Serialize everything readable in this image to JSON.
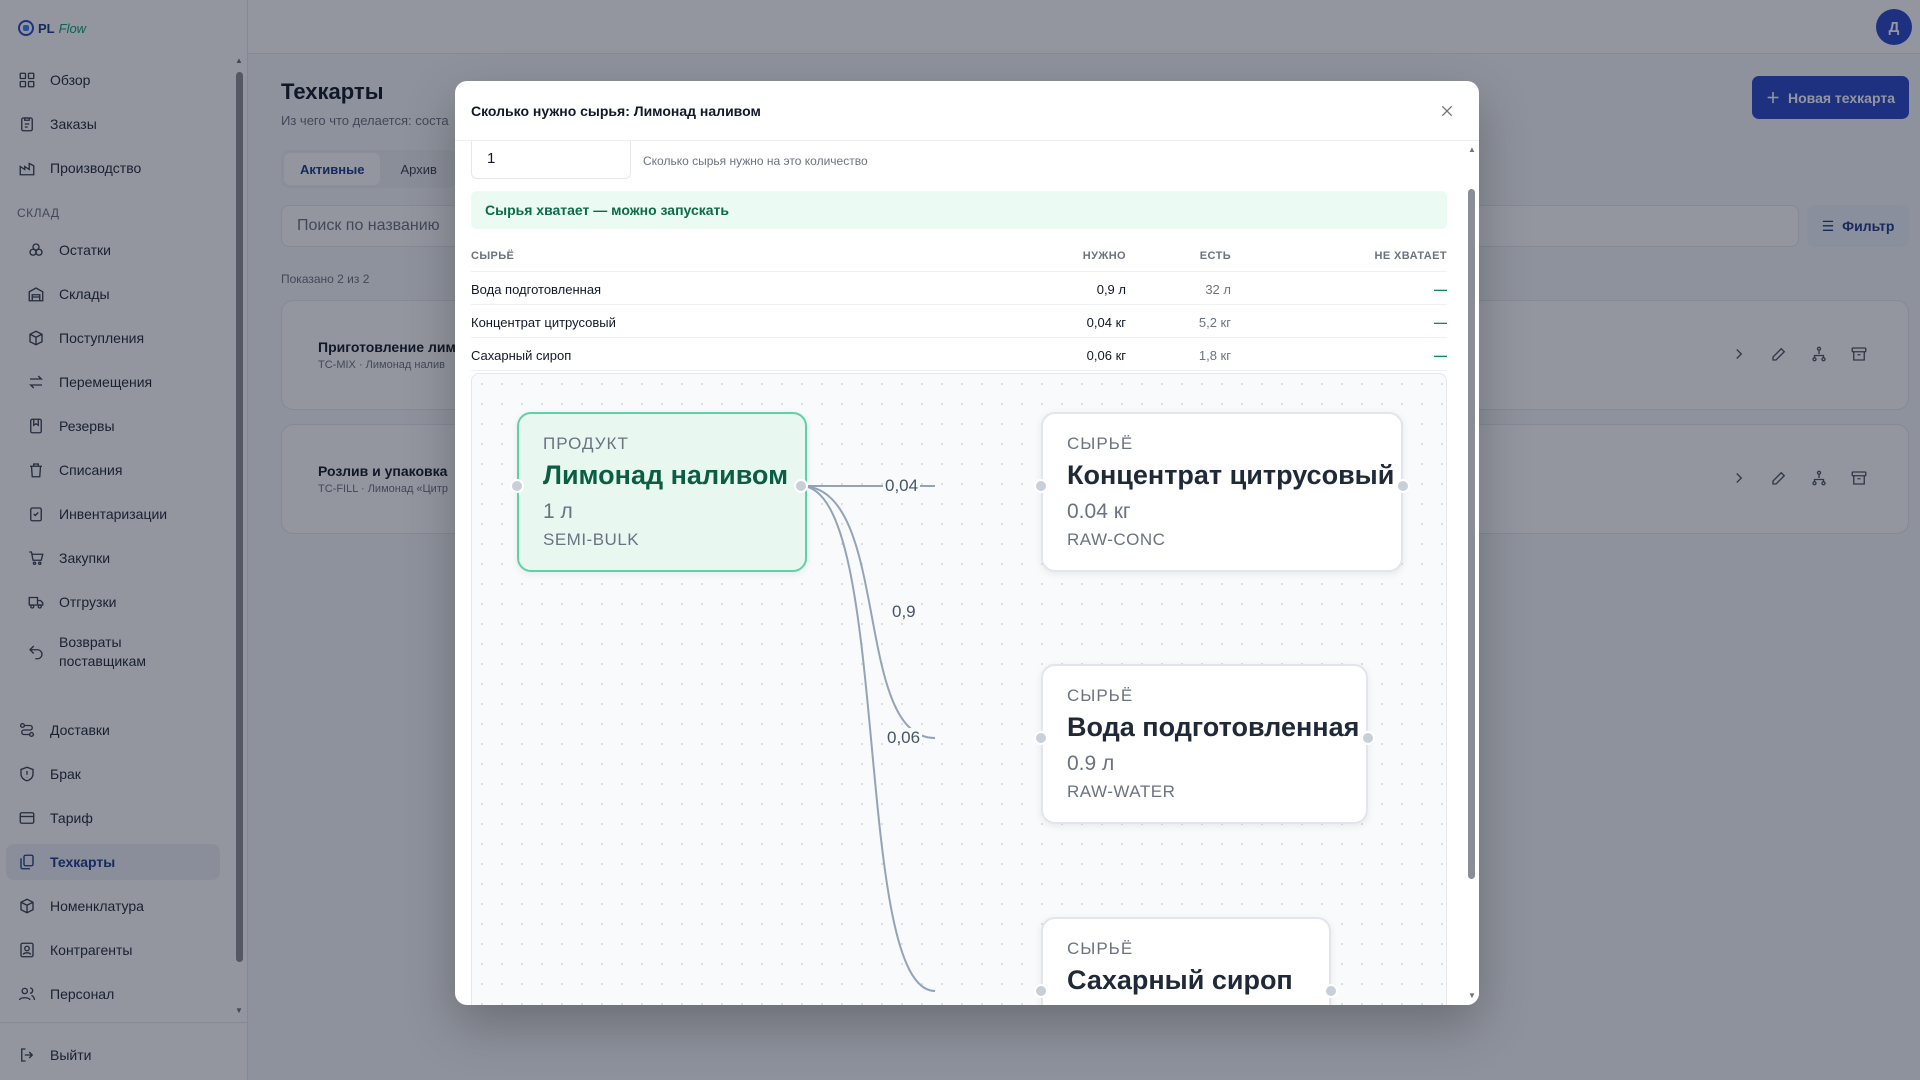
{
  "app": {
    "logo_prefix": "PL",
    "logo_suffix": "Flow",
    "user_initial": "Д"
  },
  "sidebar": {
    "items": [
      {
        "label": "Обзор",
        "icon": "grid-icon"
      },
      {
        "label": "Заказы",
        "icon": "clipboard-icon"
      },
      {
        "label": "Производство",
        "icon": "factory-icon"
      }
    ],
    "section_label": "СКЛАД",
    "warehouse_items": [
      {
        "label": "Остатки",
        "icon": "boxes-icon"
      },
      {
        "label": "Склады",
        "icon": "warehouse-icon"
      },
      {
        "label": "Поступления",
        "icon": "package-in-icon"
      },
      {
        "label": "Перемещения",
        "icon": "transfer-icon"
      },
      {
        "label": "Резервы",
        "icon": "bookmark-icon"
      },
      {
        "label": "Списания",
        "icon": "trash-icon"
      },
      {
        "label": "Инвентаризации",
        "icon": "checklist-icon"
      },
      {
        "label": "Закупки",
        "icon": "cart-icon"
      },
      {
        "label": "Отгрузки",
        "icon": "truck-icon"
      },
      {
        "label": "Возвраты поставщикам",
        "icon": "return-icon"
      }
    ],
    "bottom_items": [
      {
        "label": "Доставки",
        "icon": "route-icon"
      },
      {
        "label": "Брак",
        "icon": "shield-icon"
      },
      {
        "label": "Тариф",
        "icon": "card-icon"
      },
      {
        "label": "Техкарты",
        "icon": "layers-icon",
        "active": true
      },
      {
        "label": "Номенклатура",
        "icon": "box-icon"
      },
      {
        "label": "Контрагенты",
        "icon": "contacts-icon"
      },
      {
        "label": "Персонал",
        "icon": "users-icon"
      }
    ],
    "logout_label": "Выйти"
  },
  "page": {
    "title": "Техкарты",
    "subtitle": "Из чего что делается: соста",
    "new_button": "Новая техкарта",
    "tabs": [
      "Активные",
      "Архив"
    ],
    "search_placeholder": "Поиск по названию",
    "filter_label": "Фильтр",
    "shown_text": "Показано 2 из 2",
    "cards": [
      {
        "title": "Приготовление лимо",
        "subtitle": "TC-MIX · Лимонад налив"
      },
      {
        "title": "Розлив и упаковка",
        "subtitle": "TC-FILL · Лимонад «Цитр"
      }
    ]
  },
  "modal": {
    "title": "Сколько нужно сырья: Лимонад наливом",
    "quantity_value": "1",
    "quantity_hint": "Сколько сырья нужно на это количество",
    "status_banner": "Сырья хватает — можно запускать",
    "table": {
      "headers": [
        "СЫРЬЁ",
        "НУЖНО",
        "ЕСТЬ",
        "НЕ ХВАТАЕТ"
      ],
      "rows": [
        [
          "Вода подготовленная",
          "0,9 л",
          "32 л",
          "—"
        ],
        [
          "Концентрат цитрусовый",
          "0,04 кг",
          "5,2 кг",
          "—"
        ],
        [
          "Сахарный сироп",
          "0,06 кг",
          "1,8 кг",
          "—"
        ]
      ]
    },
    "graph": {
      "product": {
        "kind": "ПРОДУКТ",
        "name": "Лимонад наливом",
        "qty": "1 л",
        "sku": "SEMI-BULK"
      },
      "materials": [
        {
          "kind": "СЫРЬЁ",
          "name": "Концентрат цитрусовый",
          "qty": "0.04 кг",
          "sku": "RAW-CONC",
          "edge_label": "0,04"
        },
        {
          "kind": "СЫРЬЁ",
          "name": "Вода подготовленная",
          "qty": "0.9 л",
          "sku": "RAW-WATER",
          "edge_label": "0,9"
        },
        {
          "kind": "СЫРЬЁ",
          "name": "Сахарный сироп",
          "qty": "",
          "sku": "",
          "edge_label": "0,06"
        }
      ]
    }
  },
  "colors": {
    "accent": "#2a48c9",
    "success_bg": "#ebfaf3",
    "success_text": "#0b6b4a",
    "product_border": "#5fd1a7"
  }
}
